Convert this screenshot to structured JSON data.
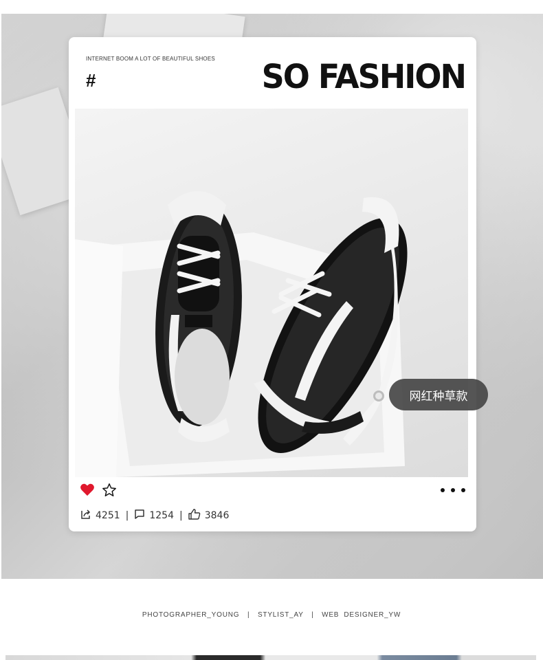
{
  "card": {
    "tagline": "INTERNET BOOM A LOT OF BEAUTIFUL SHOES",
    "hash": "#",
    "headline": "SO FASHION",
    "tag_label": "网红种草款"
  },
  "actions": {
    "heart_icon": "heart-filled",
    "star_icon": "star-outline",
    "more_icon": "more-dots"
  },
  "stats": {
    "shares": "4251",
    "comments": "1254",
    "likes": "3846",
    "separator": "|"
  },
  "credits": {
    "photographer": "PHOTOGRAPHER_YOUNG",
    "stylist": "STYLIST_AY",
    "web": "WEB  DESIGNER_YW",
    "separator": "|"
  },
  "colors": {
    "heart": "#e0182d",
    "tag_bg": "#464646",
    "text_dark": "#111111"
  }
}
